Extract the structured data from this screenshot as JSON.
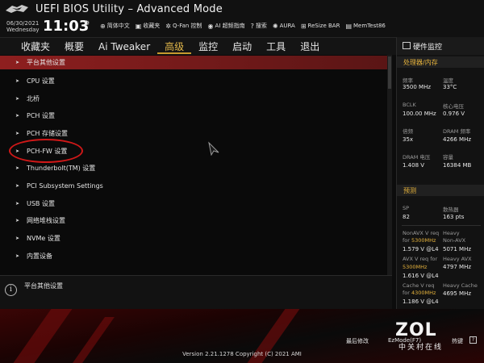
{
  "header": {
    "title": "UEFI BIOS Utility – Advanced Mode",
    "date": "06/30/2021",
    "weekday": "Wednesday",
    "time": "11:03",
    "tools": [
      {
        "icon": "globe-icon",
        "label": "简体中文"
      },
      {
        "icon": "star-icon",
        "label": "收藏夹"
      },
      {
        "icon": "fan-icon",
        "label": "Q-Fan 控制"
      },
      {
        "icon": "ai-icon",
        "label": "AI 超频指南"
      },
      {
        "icon": "question-icon",
        "label": "搜索"
      },
      {
        "icon": "aura-icon",
        "label": "AURA"
      },
      {
        "icon": "resize-bar-icon",
        "label": "ReSize BAR"
      },
      {
        "icon": "memtest-icon",
        "label": "MemTest86"
      }
    ]
  },
  "menu": {
    "tabs": [
      "收藏夹",
      "概要",
      "Ai Tweaker",
      "高级",
      "监控",
      "启动",
      "工具",
      "退出"
    ],
    "active": "高级"
  },
  "list": {
    "items": [
      "平台其他设置",
      "CPU 设置",
      "北桥",
      "PCH 设置",
      "PCH 存储设置",
      "PCH-FW 设置",
      "Thunderbolt(TM) 设置",
      "PCI Subsystem Settings",
      "USB 设置",
      "网络堆栈设置",
      "NVMe 设置",
      "内置设备"
    ]
  },
  "help": {
    "text": "平台其他设置"
  },
  "monitor": {
    "title": "硬件监控",
    "sections": [
      {
        "title": "处理器/内存",
        "pairs": [
          {
            "k1": "频率",
            "v1": "3500 MHz",
            "k2": "温度",
            "v2": "33°C"
          },
          {
            "k1": "BCLK",
            "v1": "100.00 MHz",
            "k2": "核心电压",
            "v2": "0.976 V"
          },
          {
            "k1": "倍频",
            "v1": "35x",
            "k2": "DRAM 频率",
            "v2": "4266 MHz"
          },
          {
            "k1": "DRAM 电压",
            "v1": "1.408 V",
            "k2": "容量",
            "v2": "16384 MB"
          }
        ]
      },
      {
        "title": "预测",
        "pairs": [
          {
            "k1": "SP",
            "v1": "82",
            "k2": "散热器",
            "v2": "163 pts"
          }
        ]
      }
    ],
    "prediction": [
      {
        "k1a": "NonAVX V req",
        "k1b": "for",
        "k1c": "5300MHz",
        "v1": "1.579 V @L4",
        "k2a": "Heavy",
        "k2b": "Non-AVX",
        "v2": "5071 MHz"
      },
      {
        "k1a": "AVX V req",
        "k1b": "for",
        "k1c": "5300MHz",
        "v1": "1.616 V @L4",
        "k2a": "Heavy AVX",
        "k2b": "",
        "v2": "4797 MHz"
      },
      {
        "k1a": "Cache V req",
        "k1b": "for",
        "k1c": "4300MHz",
        "v1": "1.186 V @L4",
        "k2a": "Heavy Cache",
        "k2b": "",
        "v2": "4695 MHz"
      }
    ]
  },
  "footer": {
    "last_modified": "最后修改",
    "ez_mode": "EzMode(F7)",
    "hotkey": "热键",
    "version": "Version 2.21.1278 Copyright (C) 2021 AMI"
  },
  "watermark": {
    "brand": "ZOL",
    "subtitle": "中关村在线"
  },
  "colors": {
    "accent": "#e0b64a",
    "selection": "#8e1f1f",
    "highlight_circle": "#d01818"
  }
}
